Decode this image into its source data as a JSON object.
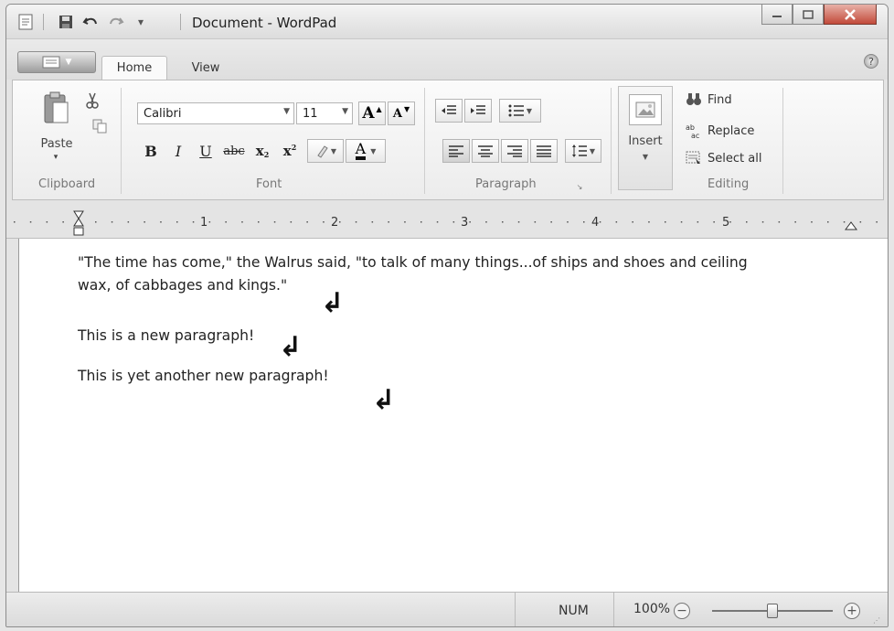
{
  "window": {
    "title": "Document - WordPad"
  },
  "tabs": [
    {
      "label": "Home"
    },
    {
      "label": "View"
    }
  ],
  "ribbon": {
    "clipboard": {
      "group_label": "Clipboard",
      "paste_label": "Paste"
    },
    "font": {
      "group_label": "Font",
      "family_value": "Calibri",
      "size_value": "11",
      "bold_label": "B",
      "italic_label": "I",
      "underline_label": "U",
      "strike_label": "abc",
      "subscript_label": "x",
      "superscript_label": "x",
      "grow_label": "A",
      "shrink_label": "A",
      "color_label": "A"
    },
    "paragraph": {
      "group_label": "Paragraph"
    },
    "insert": {
      "label": "Insert"
    },
    "editing": {
      "group_label": "Editing",
      "find_label": "Find",
      "replace_label": "Replace",
      "select_all_label": "Select all"
    }
  },
  "ruler": {
    "numbers": [
      "1",
      "2",
      "3",
      "4",
      "5"
    ]
  },
  "document": {
    "paragraphs": [
      {
        "lines": [
          "\"The time has come,\" the Walrus said, \"to talk of many things...of ships and shoes and ceiling",
          "wax, of cabbages and kings.\""
        ]
      },
      {
        "lines": [
          "This is a new paragraph!"
        ]
      },
      {
        "lines": [
          "This is yet another new paragraph!"
        ]
      }
    ]
  },
  "status": {
    "num_lock": "NUM",
    "zoom": "100%",
    "zoom_percent": 100
  },
  "colors": {
    "window_bg": "#e4e4e4",
    "document_bg": "#ffffff",
    "close_button": "#c24a3a"
  }
}
